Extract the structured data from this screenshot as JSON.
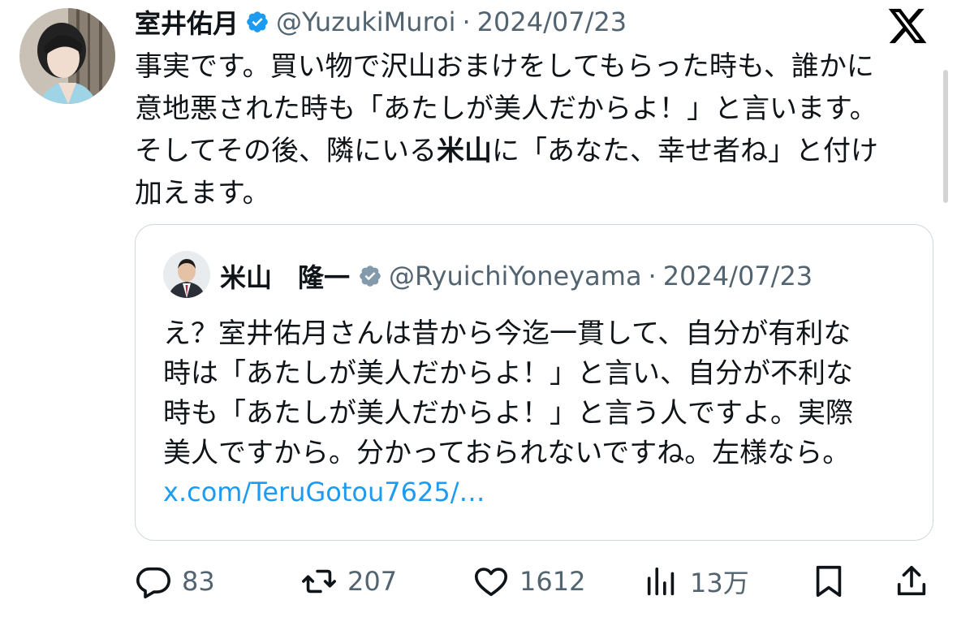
{
  "tweet": {
    "name": "室井佑月",
    "handle": "@YuzukiMuroi",
    "separator": "·",
    "date": "2024/07/23",
    "text": {
      "line1": "事実です。買い物で沢山おまけをしてもらった時も、誰かに",
      "line2": "意地悪された時も「あたしが美人だからよ！」と言います。",
      "line3a": "そしてその後、隣にいる",
      "line3b": "米山",
      "line3c": "に「あなた、幸せ者ね」と付け",
      "line4": "加えます。"
    }
  },
  "quote": {
    "name": "米山　隆一",
    "handle": "@RyuichiYoneyama",
    "separator": "·",
    "date": "2024/07/23",
    "text": {
      "line1": "え？室井佑月さんは昔から今迄一貫して、自分が有利な",
      "line2": "時は「あたしが美人だからよ！」と言い、自分が不利な",
      "line3": "時も「あたしが美人だからよ！」と言う人ですよ。実際",
      "line4": "美人ですから。分かっておられないですね。左様なら。"
    },
    "link": "x.com/TeruGotou7625/…"
  },
  "actions": {
    "replies": "83",
    "reposts": "207",
    "likes": "1612",
    "views": "13万"
  },
  "colors": {
    "text": "#0f1419",
    "secondary": "#536471",
    "link": "#1d9bf0",
    "verified": "#1d9bf0",
    "border": "#cfd9de"
  },
  "icons": [
    "verified-badge-icon",
    "x-logo-icon",
    "reply-icon",
    "repost-icon",
    "like-icon",
    "views-icon",
    "bookmark-icon",
    "share-icon"
  ]
}
